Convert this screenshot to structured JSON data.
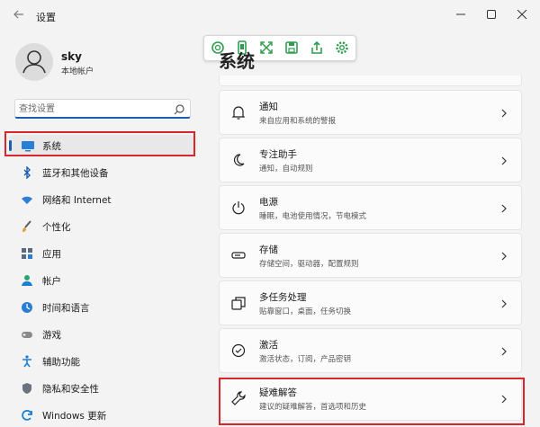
{
  "window": {
    "title": "设置",
    "back_icon": "arrow-left-icon",
    "controls": [
      "minimize-icon",
      "maximize-icon",
      "close-icon"
    ]
  },
  "toolbar": {
    "icons": [
      "search-scan-icon",
      "phone-icon",
      "expand-icon",
      "save-icon",
      "share-icon",
      "gear-icon"
    ],
    "accent": "#2e9e4e"
  },
  "profile": {
    "name": "sky",
    "account_type": "本地帐户"
  },
  "search": {
    "placeholder": "查找设置"
  },
  "sidebar": {
    "items": [
      {
        "label": "系统",
        "icon": "display-icon",
        "active": true
      },
      {
        "label": "蓝牙和其他设备",
        "icon": "bluetooth-icon"
      },
      {
        "label": "网络和 Internet",
        "icon": "wifi-icon"
      },
      {
        "label": "个性化",
        "icon": "brush-icon"
      },
      {
        "label": "应用",
        "icon": "apps-icon"
      },
      {
        "label": "帐户",
        "icon": "person-icon"
      },
      {
        "label": "时间和语言",
        "icon": "globe-clock-icon"
      },
      {
        "label": "游戏",
        "icon": "gamepad-icon"
      },
      {
        "label": "辅助功能",
        "icon": "accessibility-icon"
      },
      {
        "label": "隐私和安全性",
        "icon": "shield-icon"
      },
      {
        "label": "Windows 更新",
        "icon": "windows-update-icon"
      }
    ]
  },
  "main": {
    "title": "系统",
    "cards": [
      {
        "title": "通知",
        "subtitle": "来自应用和系统的警报",
        "icon": "bell-icon"
      },
      {
        "title": "专注助手",
        "subtitle": "通知，自动规则",
        "icon": "moon-icon"
      },
      {
        "title": "电源",
        "subtitle": "睡眠，电池使用情况，节电模式",
        "icon": "power-icon"
      },
      {
        "title": "存储",
        "subtitle": "存储空间，驱动器，配置规则",
        "icon": "storage-icon"
      },
      {
        "title": "多任务处理",
        "subtitle": "贴靠窗口，桌面，任务切换",
        "icon": "multitask-icon"
      },
      {
        "title": "激活",
        "subtitle": "激活状态，订阅，产品密钥",
        "icon": "check-circle-icon"
      },
      {
        "title": "疑难解答",
        "subtitle": "建议的疑难解答，首选项和历史",
        "icon": "wrench-icon"
      }
    ]
  },
  "colors": {
    "highlight": "#d9252b",
    "accent": "#1a5fb4"
  }
}
